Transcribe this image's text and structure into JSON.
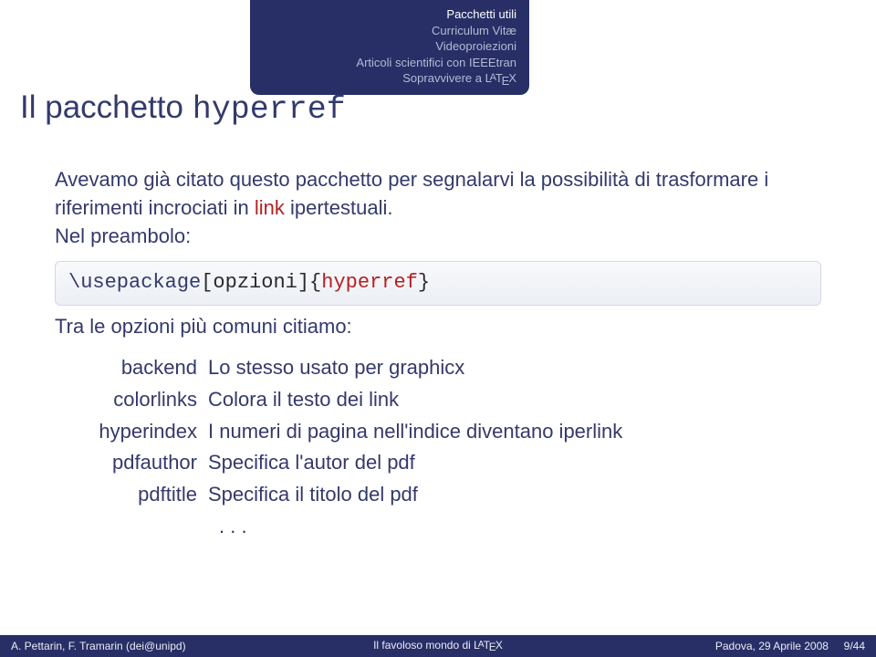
{
  "header": {
    "items": [
      "Pacchetti utili",
      "Curriculum Vitæ",
      "Videoproiezioni",
      "Articoli scientifici con IEEEtran"
    ],
    "lastline_prefix": "Sopravvivere a "
  },
  "frametitle": {
    "prefix": "Il pacchetto ",
    "tt": "hyperref"
  },
  "intro": {
    "part1": "Avevamo già citato questo pacchetto per segnalarvi la possibilità di trasformare i riferimenti incrociati in ",
    "linkword": "link",
    "part2": " ipertestuali.",
    "line2": "Nel preambolo:"
  },
  "code": {
    "cmd": "\\usepackage",
    "mid": "[opzioni]{",
    "arg": "hyperref",
    "end": "}"
  },
  "opts_intro": "Tra le opzioni più comuni citiamo:",
  "options": [
    {
      "term": "backend",
      "desc": "Lo stesso usato per graphicx"
    },
    {
      "term": "colorlinks",
      "desc": "Colora il testo dei link"
    },
    {
      "term": "hyperindex",
      "desc": "I numeri di pagina nell'indice diventano iperlink"
    },
    {
      "term": "pdfauthor",
      "desc": "Specifica l'autor del pdf"
    },
    {
      "term": "pdftitle",
      "desc": "Specifica il titolo del pdf"
    }
  ],
  "ellipsis": ". . .",
  "footer": {
    "left": "A. Pettarin, F. Tramarin (dei@unipd)",
    "center_prefix": "Il favoloso mondo di ",
    "right_date": "Padova, 29 Aprile 2008",
    "page": "9/44"
  }
}
